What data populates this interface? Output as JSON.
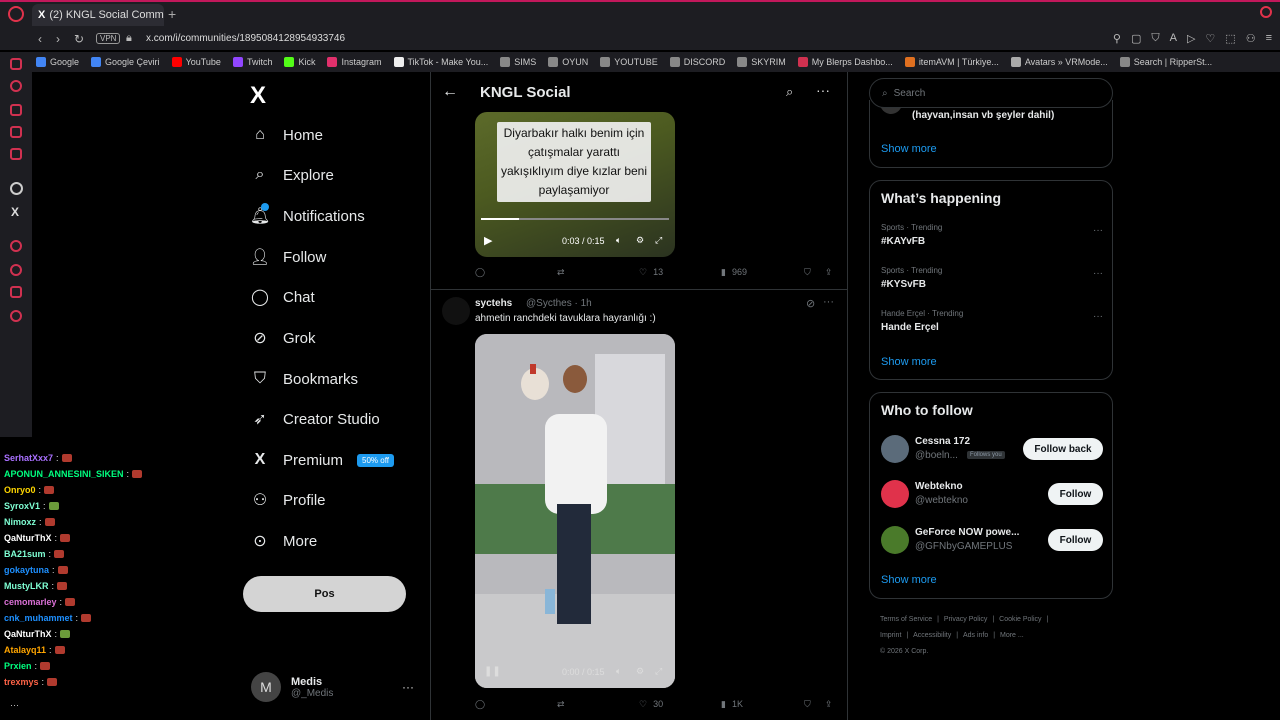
{
  "browser": {
    "tab_title": "(2) KNGL Social Comm",
    "tab_icon": "X",
    "tab_close": "✕",
    "new_tab": "+",
    "vpn_label": "VPN",
    "url": "x.com/i/communities/1895084128954933746",
    "bookmarks": [
      "Google",
      "Google Çeviri",
      "YouTube",
      "Twitch",
      "Kick",
      "Instagram",
      "TikTok - Make You...",
      "SIMS",
      "OYUN",
      "YOUTUBE",
      "DISCORD",
      "SKYRIM",
      "My Blerps Dashbo...",
      "itemAVM | Türkiye...",
      "Avatars » VRMode...",
      "Search | RipperSt..."
    ],
    "bookmark_colors": [
      "#4285f4",
      "#4285f4",
      "#ff0000",
      "#9146ff",
      "#53fc18",
      "#e1306c",
      "#eeeeee",
      "#888888",
      "#888888",
      "#888888",
      "#888888",
      "#888888",
      "#d03150",
      "#e07020",
      "#aaaaaa",
      "#888888"
    ]
  },
  "nav": {
    "logo": "X",
    "items": [
      {
        "label": "Home",
        "icon": "home-icon",
        "glyph": "⌂"
      },
      {
        "label": "Explore",
        "icon": "search-icon",
        "glyph": "⌕"
      },
      {
        "label": "Notifications",
        "icon": "bell-icon",
        "glyph": "🔔︎"
      },
      {
        "label": "Follow",
        "icon": "add-user-icon",
        "glyph": "👤︎"
      },
      {
        "label": "Chat",
        "icon": "chat-bubble-icon",
        "glyph": "◯"
      },
      {
        "label": "Grok",
        "icon": "grok-icon",
        "glyph": "⊘"
      },
      {
        "label": "Bookmarks",
        "icon": "bookmark-icon",
        "glyph": "⛉"
      },
      {
        "label": "Creator Studio",
        "icon": "rocket-icon",
        "glyph": "➶"
      },
      {
        "label": "Premium",
        "icon": "x-premium-icon",
        "glyph": "X"
      },
      {
        "label": "Profile",
        "icon": "person-icon",
        "glyph": "⚇"
      },
      {
        "label": "More",
        "icon": "more-circle-icon",
        "glyph": "⊙"
      }
    ],
    "premium_badge": "50% off",
    "post_button": "Pos",
    "account": {
      "initial": "M",
      "name": "Medis",
      "handle": "@_Medis",
      "more": "···"
    }
  },
  "community": {
    "title": "KNGL Social",
    "video1": {
      "caption": "Diyarbakır halkı benim için çatışmalar yarattı yakışıklıyım diye kızlar beni paylaşamiyor",
      "time": "0:03 / 0:15",
      "progress": 0.2
    },
    "post1_actions": {
      "likes": "13",
      "views": "969"
    },
    "post2": {
      "name": "syctehs",
      "handle": "@Sycthes · 1h",
      "text": "ahmetin ranchdeki tavuklara hayranlığı :)",
      "video_time": "0:00 / 0:15",
      "likes": "30",
      "views": "1K"
    }
  },
  "right": {
    "search_placeholder": "Search",
    "card1_text": "(hayvan,insan vb şeyler dahil)",
    "show_more": "Show more",
    "whats_happening": "What’s happening",
    "trends": [
      {
        "meta": "Sports · Trending",
        "name": "#KAYvFB"
      },
      {
        "meta": "Sports · Trending",
        "name": "#KYSvFB"
      },
      {
        "meta": "Hande Erçel · Trending",
        "name": "Hande Erçel"
      }
    ],
    "who_to_follow": "Who to follow",
    "follow_suggestions": [
      {
        "name": "Cessna 172",
        "handle": "@boeln...",
        "badge": "Follows you",
        "button": "Follow back",
        "avatar_color": "#5b6b7a"
      },
      {
        "name": "Webtekno",
        "handle": "@webtekno",
        "badge": "",
        "button": "Follow",
        "avatar_color": "#e0324b"
      },
      {
        "name": "GeForce NOW powe...",
        "handle": "@GFNbyGAMEPLUS",
        "badge": "",
        "button": "Follow",
        "avatar_color": "#4a7a2a"
      }
    ],
    "footer": {
      "links": [
        "Terms of Service",
        "Privacy Policy",
        "Cookie Policy",
        "Imprint",
        "Accessibility",
        "Ads info",
        "More ..."
      ],
      "copyright": "© 2026 X Corp."
    }
  },
  "chat": [
    {
      "user": "SerhatXxx7",
      "color": "#a970ff",
      "emote": "red"
    },
    {
      "user": "APONUN_ANNESINI_SIKEN",
      "color": "#00ff7f",
      "emote": "red"
    },
    {
      "user": "Onryo0",
      "color": "#ffd700",
      "emote": "red"
    },
    {
      "user": "SyroxV1",
      "color": "#7fffd4",
      "emote": "green"
    },
    {
      "user": "Nimoxz",
      "color": "#7fffd4",
      "emote": "red"
    },
    {
      "user": "QaNturThX",
      "color": "#ffffff",
      "emote": "red"
    },
    {
      "user": "BA21sum",
      "color": "#7fffd4",
      "emote": "red"
    },
    {
      "user": "gokaytuna",
      "color": "#1e90ff",
      "emote": "red"
    },
    {
      "user": "MustyLKR",
      "color": "#7fffd4",
      "emote": "red"
    },
    {
      "user": "cemomarley",
      "color": "#da70d6",
      "emote": "red"
    },
    {
      "user": "cnk_muhammet",
      "color": "#1e90ff",
      "emote": "red"
    },
    {
      "user": "QaNturThX",
      "color": "#ffffff",
      "emote": "green"
    },
    {
      "user": "Atalayq11",
      "color": "#ffa500",
      "emote": "red"
    },
    {
      "user": "Prxien",
      "color": "#00ff7f",
      "emote": "red"
    },
    {
      "user": "trexmys",
      "color": "#ff6347",
      "emote": "red"
    }
  ]
}
